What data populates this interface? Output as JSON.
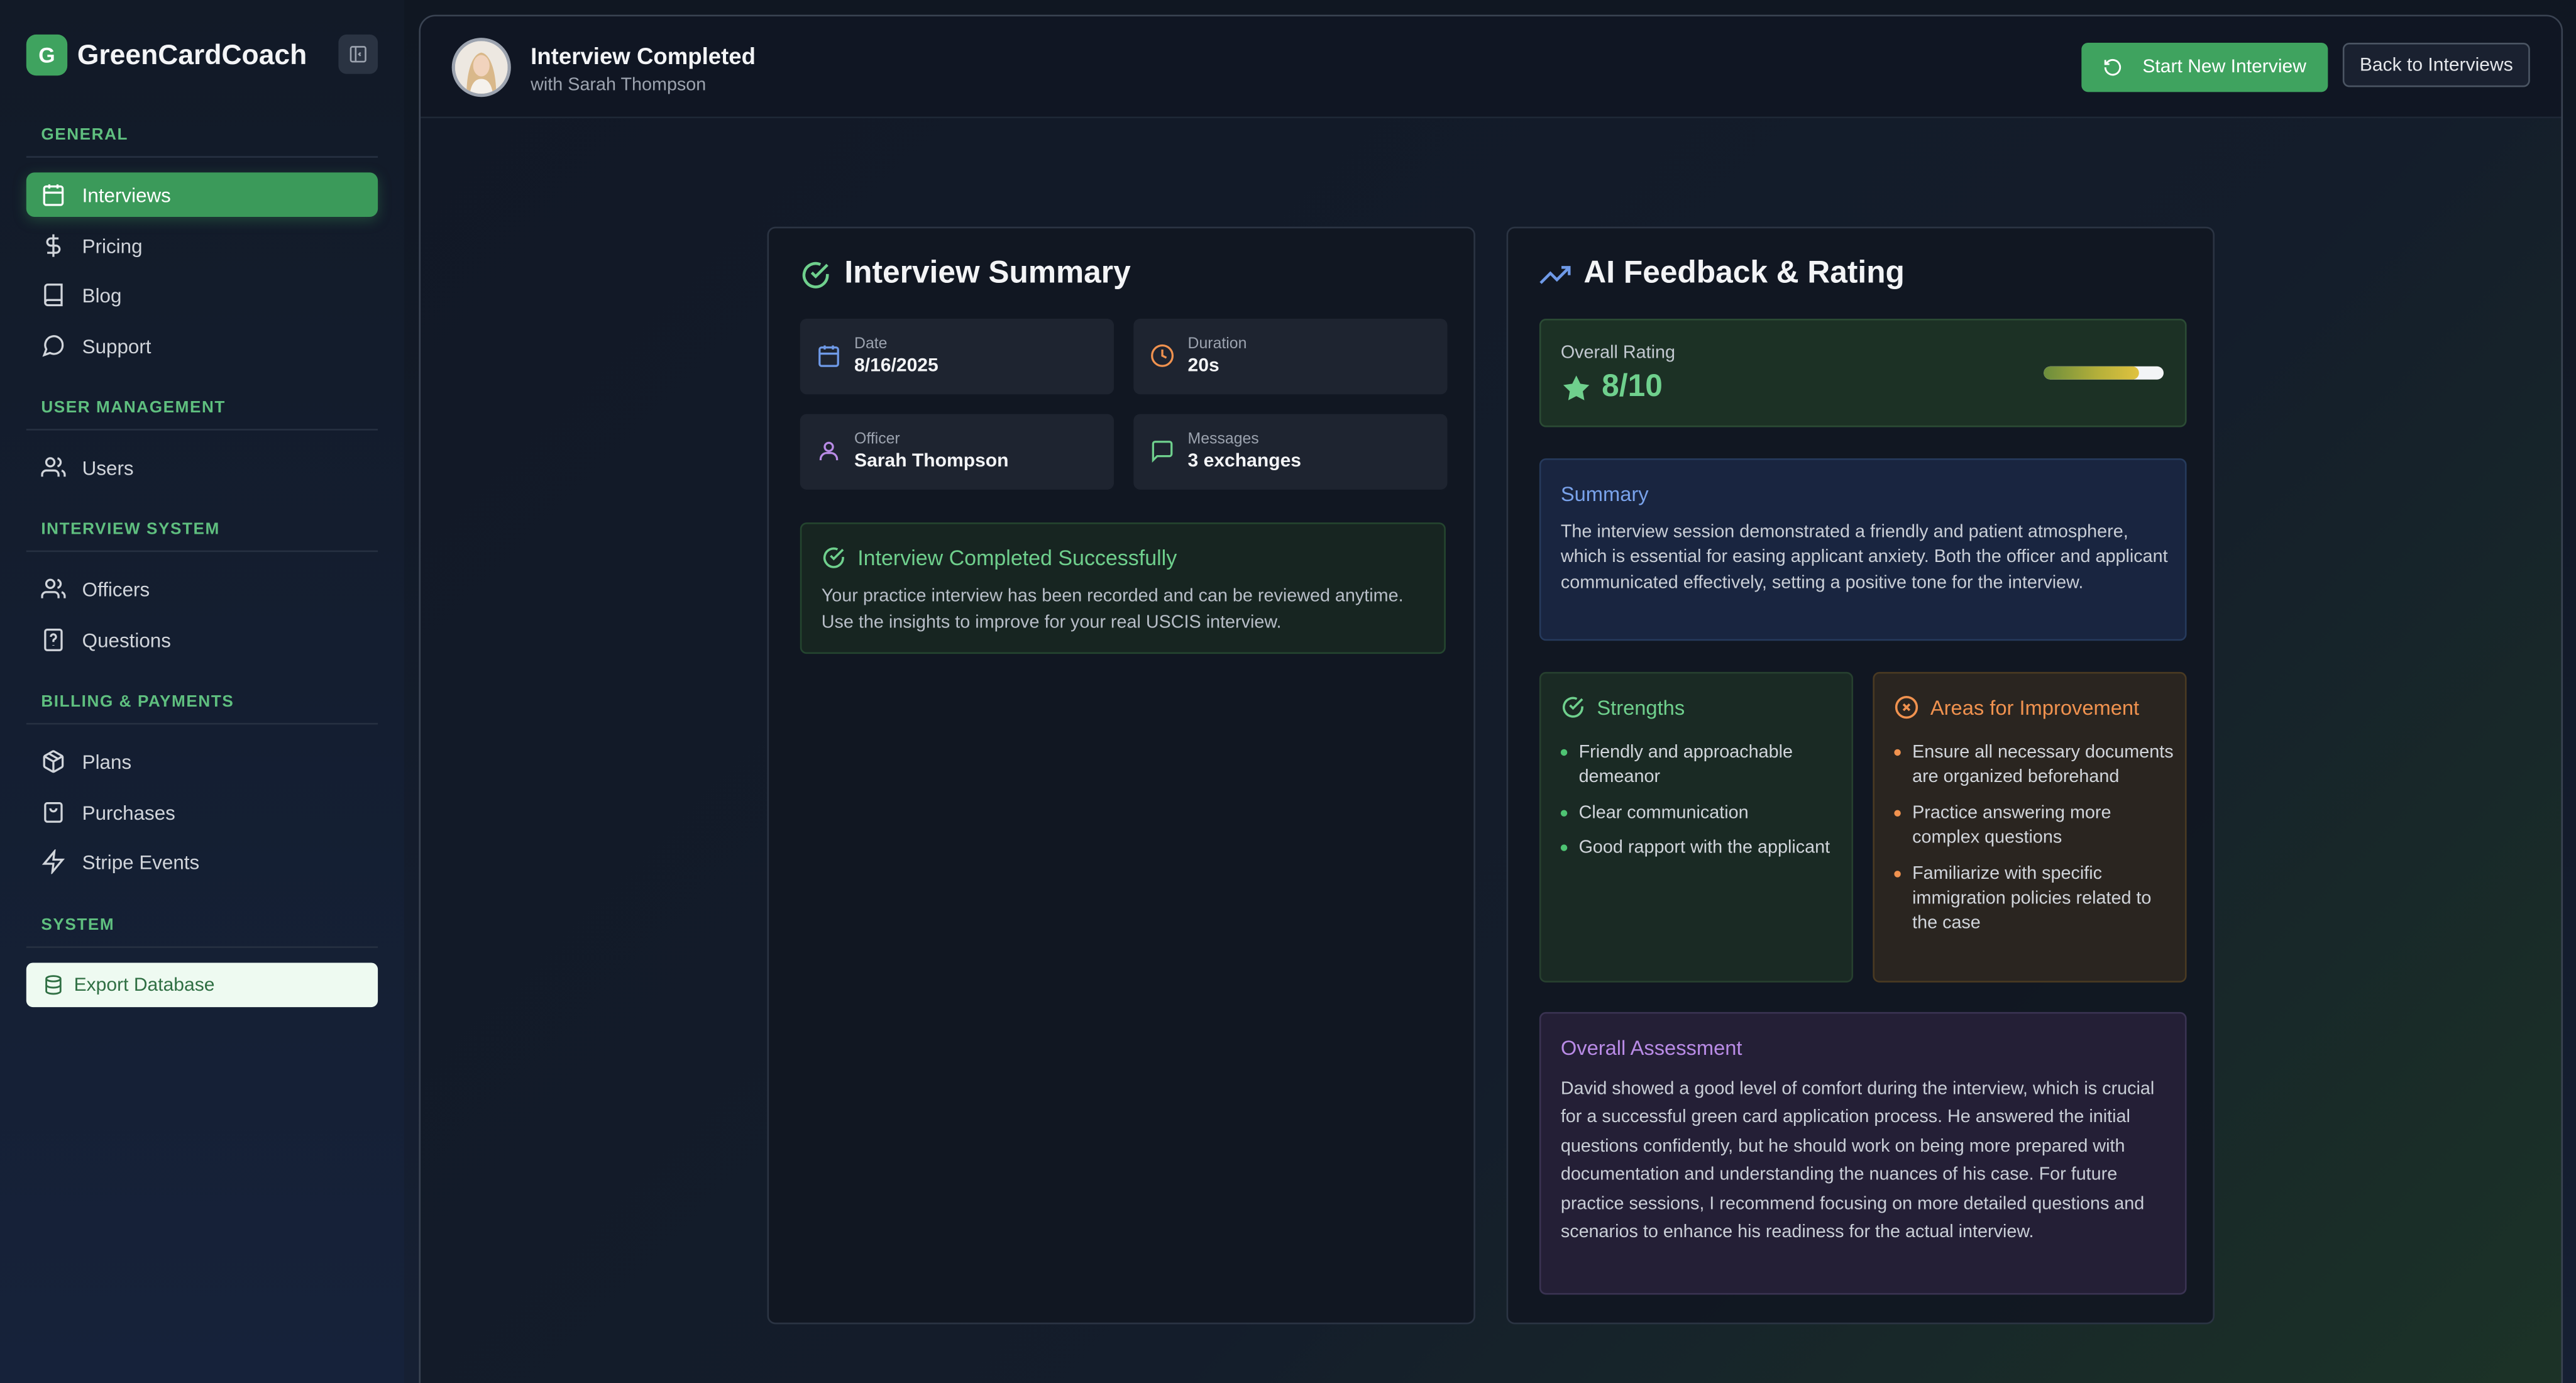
{
  "app": {
    "logo_letter": "G",
    "name": "GreenCardCoach"
  },
  "sidebar": {
    "sections": [
      {
        "title": "GENERAL",
        "items": [
          {
            "label": "Interviews",
            "icon": "calendar-icon",
            "active": true
          },
          {
            "label": "Pricing",
            "icon": "dollar-icon"
          },
          {
            "label": "Blog",
            "icon": "book-icon"
          },
          {
            "label": "Support",
            "icon": "message-circle-icon"
          }
        ]
      },
      {
        "title": "USER MANAGEMENT",
        "items": [
          {
            "label": "Users",
            "icon": "users-icon"
          }
        ]
      },
      {
        "title": "INTERVIEW SYSTEM",
        "items": [
          {
            "label": "Officers",
            "icon": "users-icon"
          },
          {
            "label": "Questions",
            "icon": "help-file-icon"
          }
        ]
      },
      {
        "title": "BILLING & PAYMENTS",
        "items": [
          {
            "label": "Plans",
            "icon": "package-icon"
          },
          {
            "label": "Purchases",
            "icon": "shopping-bag-icon"
          },
          {
            "label": "Stripe Events",
            "icon": "zap-icon"
          }
        ]
      },
      {
        "title": "SYSTEM",
        "items": []
      }
    ],
    "export_label": "Export Database"
  },
  "header": {
    "title": "Interview Completed",
    "subtitle": "with Sarah Thompson",
    "start_new_label": "Start New Interview",
    "back_label": "Back to Interviews"
  },
  "summary": {
    "title": "Interview Summary",
    "date_label": "Date",
    "date_value": "8/16/2025",
    "duration_label": "Duration",
    "duration_value": "20s",
    "officer_label": "Officer",
    "officer_value": "Sarah Thompson",
    "messages_label": "Messages",
    "messages_value": "3 exchanges",
    "success_title": "Interview Completed Successfully",
    "success_text": "Your practice interview has been recorded and can be reviewed anytime. Use the insights to improve for your real USCIS interview."
  },
  "feedback": {
    "title": "AI Feedback & Rating",
    "rating_label": "Overall Rating",
    "rating_value": "8/10",
    "rating_fraction": 0.8,
    "summary_title": "Summary",
    "summary_text": "The interview session demonstrated a friendly and patient atmosphere, which is essential for easing applicant anxiety. Both the officer and applicant communicated effectively, setting a positive tone for the interview.",
    "strengths_title": "Strengths",
    "strengths": [
      "Friendly and approachable demeanor",
      "Clear communication",
      "Good rapport with the applicant"
    ],
    "improvement_title": "Areas for Improvement",
    "improvements": [
      "Ensure all necessary documents are organized beforehand",
      "Practice answering more complex questions",
      "Familiarize with specific immigration policies related to the case"
    ],
    "assessment_title": "Overall Assessment",
    "assessment_text": "David showed a good level of comfort during the interview, which is crucial for a successful green card application process. He answered the initial questions confidently, but he should work on being more prepared with documentation and understanding the nuances of his case. For future practice sessions, I recommend focusing on more detailed questions and scenarios to enhance his readiness for the actual interview."
  },
  "colors": {
    "accent": "#3fa35f",
    "success": "#6fd08d",
    "warning": "#f0924f",
    "info": "#79a2ea",
    "purple": "#b98be6"
  }
}
